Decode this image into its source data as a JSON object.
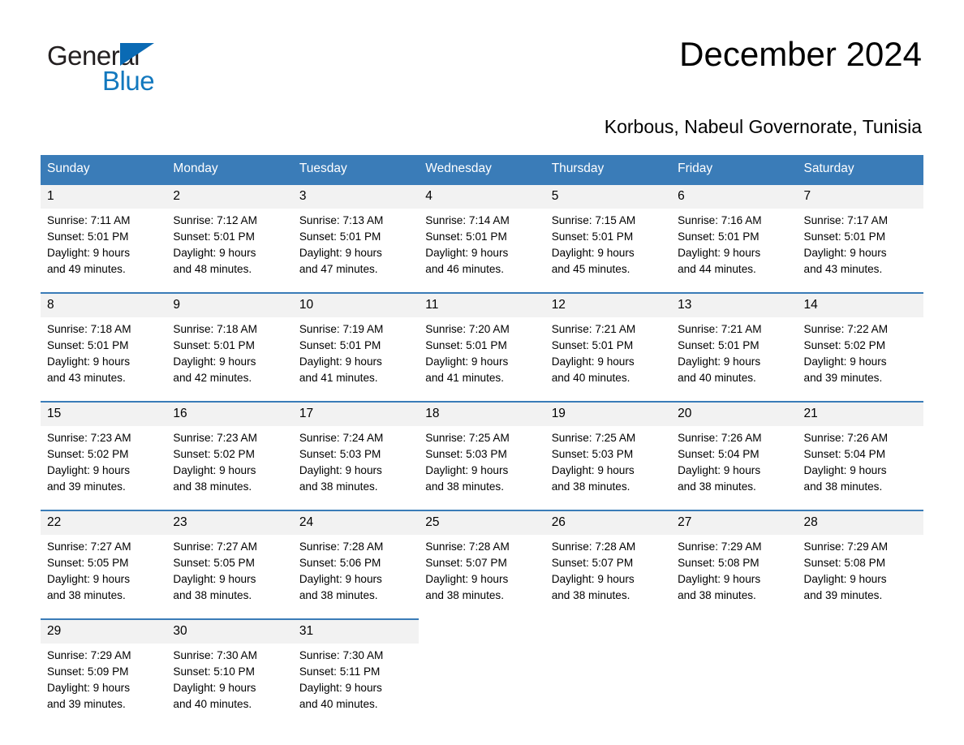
{
  "logo": {
    "word_one": "General",
    "word_two": "Blue",
    "flag_icon": "triangle-flag-icon",
    "brand_color": "#1278be"
  },
  "header": {
    "month_title": "December 2024",
    "location": "Korbous, Nabeul Governorate, Tunisia"
  },
  "calendar": {
    "header_color": "#3a7cb8",
    "weekday_headers": [
      "Sunday",
      "Monday",
      "Tuesday",
      "Wednesday",
      "Thursday",
      "Friday",
      "Saturday"
    ],
    "weeks": [
      [
        {
          "day": "1",
          "sunrise": "Sunrise: 7:11 AM",
          "sunset": "Sunset: 5:01 PM",
          "daylight_line1": "Daylight: 9 hours",
          "daylight_line2": "and 49 minutes."
        },
        {
          "day": "2",
          "sunrise": "Sunrise: 7:12 AM",
          "sunset": "Sunset: 5:01 PM",
          "daylight_line1": "Daylight: 9 hours",
          "daylight_line2": "and 48 minutes."
        },
        {
          "day": "3",
          "sunrise": "Sunrise: 7:13 AM",
          "sunset": "Sunset: 5:01 PM",
          "daylight_line1": "Daylight: 9 hours",
          "daylight_line2": "and 47 minutes."
        },
        {
          "day": "4",
          "sunrise": "Sunrise: 7:14 AM",
          "sunset": "Sunset: 5:01 PM",
          "daylight_line1": "Daylight: 9 hours",
          "daylight_line2": "and 46 minutes."
        },
        {
          "day": "5",
          "sunrise": "Sunrise: 7:15 AM",
          "sunset": "Sunset: 5:01 PM",
          "daylight_line1": "Daylight: 9 hours",
          "daylight_line2": "and 45 minutes."
        },
        {
          "day": "6",
          "sunrise": "Sunrise: 7:16 AM",
          "sunset": "Sunset: 5:01 PM",
          "daylight_line1": "Daylight: 9 hours",
          "daylight_line2": "and 44 minutes."
        },
        {
          "day": "7",
          "sunrise": "Sunrise: 7:17 AM",
          "sunset": "Sunset: 5:01 PM",
          "daylight_line1": "Daylight: 9 hours",
          "daylight_line2": "and 43 minutes."
        }
      ],
      [
        {
          "day": "8",
          "sunrise": "Sunrise: 7:18 AM",
          "sunset": "Sunset: 5:01 PM",
          "daylight_line1": "Daylight: 9 hours",
          "daylight_line2": "and 43 minutes."
        },
        {
          "day": "9",
          "sunrise": "Sunrise: 7:18 AM",
          "sunset": "Sunset: 5:01 PM",
          "daylight_line1": "Daylight: 9 hours",
          "daylight_line2": "and 42 minutes."
        },
        {
          "day": "10",
          "sunrise": "Sunrise: 7:19 AM",
          "sunset": "Sunset: 5:01 PM",
          "daylight_line1": "Daylight: 9 hours",
          "daylight_line2": "and 41 minutes."
        },
        {
          "day": "11",
          "sunrise": "Sunrise: 7:20 AM",
          "sunset": "Sunset: 5:01 PM",
          "daylight_line1": "Daylight: 9 hours",
          "daylight_line2": "and 41 minutes."
        },
        {
          "day": "12",
          "sunrise": "Sunrise: 7:21 AM",
          "sunset": "Sunset: 5:01 PM",
          "daylight_line1": "Daylight: 9 hours",
          "daylight_line2": "and 40 minutes."
        },
        {
          "day": "13",
          "sunrise": "Sunrise: 7:21 AM",
          "sunset": "Sunset: 5:01 PM",
          "daylight_line1": "Daylight: 9 hours",
          "daylight_line2": "and 40 minutes."
        },
        {
          "day": "14",
          "sunrise": "Sunrise: 7:22 AM",
          "sunset": "Sunset: 5:02 PM",
          "daylight_line1": "Daylight: 9 hours",
          "daylight_line2": "and 39 minutes."
        }
      ],
      [
        {
          "day": "15",
          "sunrise": "Sunrise: 7:23 AM",
          "sunset": "Sunset: 5:02 PM",
          "daylight_line1": "Daylight: 9 hours",
          "daylight_line2": "and 39 minutes."
        },
        {
          "day": "16",
          "sunrise": "Sunrise: 7:23 AM",
          "sunset": "Sunset: 5:02 PM",
          "daylight_line1": "Daylight: 9 hours",
          "daylight_line2": "and 38 minutes."
        },
        {
          "day": "17",
          "sunrise": "Sunrise: 7:24 AM",
          "sunset": "Sunset: 5:03 PM",
          "daylight_line1": "Daylight: 9 hours",
          "daylight_line2": "and 38 minutes."
        },
        {
          "day": "18",
          "sunrise": "Sunrise: 7:25 AM",
          "sunset": "Sunset: 5:03 PM",
          "daylight_line1": "Daylight: 9 hours",
          "daylight_line2": "and 38 minutes."
        },
        {
          "day": "19",
          "sunrise": "Sunrise: 7:25 AM",
          "sunset": "Sunset: 5:03 PM",
          "daylight_line1": "Daylight: 9 hours",
          "daylight_line2": "and 38 minutes."
        },
        {
          "day": "20",
          "sunrise": "Sunrise: 7:26 AM",
          "sunset": "Sunset: 5:04 PM",
          "daylight_line1": "Daylight: 9 hours",
          "daylight_line2": "and 38 minutes."
        },
        {
          "day": "21",
          "sunrise": "Sunrise: 7:26 AM",
          "sunset": "Sunset: 5:04 PM",
          "daylight_line1": "Daylight: 9 hours",
          "daylight_line2": "and 38 minutes."
        }
      ],
      [
        {
          "day": "22",
          "sunrise": "Sunrise: 7:27 AM",
          "sunset": "Sunset: 5:05 PM",
          "daylight_line1": "Daylight: 9 hours",
          "daylight_line2": "and 38 minutes."
        },
        {
          "day": "23",
          "sunrise": "Sunrise: 7:27 AM",
          "sunset": "Sunset: 5:05 PM",
          "daylight_line1": "Daylight: 9 hours",
          "daylight_line2": "and 38 minutes."
        },
        {
          "day": "24",
          "sunrise": "Sunrise: 7:28 AM",
          "sunset": "Sunset: 5:06 PM",
          "daylight_line1": "Daylight: 9 hours",
          "daylight_line2": "and 38 minutes."
        },
        {
          "day": "25",
          "sunrise": "Sunrise: 7:28 AM",
          "sunset": "Sunset: 5:07 PM",
          "daylight_line1": "Daylight: 9 hours",
          "daylight_line2": "and 38 minutes."
        },
        {
          "day": "26",
          "sunrise": "Sunrise: 7:28 AM",
          "sunset": "Sunset: 5:07 PM",
          "daylight_line1": "Daylight: 9 hours",
          "daylight_line2": "and 38 minutes."
        },
        {
          "day": "27",
          "sunrise": "Sunrise: 7:29 AM",
          "sunset": "Sunset: 5:08 PM",
          "daylight_line1": "Daylight: 9 hours",
          "daylight_line2": "and 38 minutes."
        },
        {
          "day": "28",
          "sunrise": "Sunrise: 7:29 AM",
          "sunset": "Sunset: 5:08 PM",
          "daylight_line1": "Daylight: 9 hours",
          "daylight_line2": "and 39 minutes."
        }
      ],
      [
        {
          "day": "29",
          "sunrise": "Sunrise: 7:29 AM",
          "sunset": "Sunset: 5:09 PM",
          "daylight_line1": "Daylight: 9 hours",
          "daylight_line2": "and 39 minutes."
        },
        {
          "day": "30",
          "sunrise": "Sunrise: 7:30 AM",
          "sunset": "Sunset: 5:10 PM",
          "daylight_line1": "Daylight: 9 hours",
          "daylight_line2": "and 40 minutes."
        },
        {
          "day": "31",
          "sunrise": "Sunrise: 7:30 AM",
          "sunset": "Sunset: 5:11 PM",
          "daylight_line1": "Daylight: 9 hours",
          "daylight_line2": "and 40 minutes."
        },
        {
          "day": "",
          "sunrise": "",
          "sunset": "",
          "daylight_line1": "",
          "daylight_line2": ""
        },
        {
          "day": "",
          "sunrise": "",
          "sunset": "",
          "daylight_line1": "",
          "daylight_line2": ""
        },
        {
          "day": "",
          "sunrise": "",
          "sunset": "",
          "daylight_line1": "",
          "daylight_line2": ""
        },
        {
          "day": "",
          "sunrise": "",
          "sunset": "",
          "daylight_line1": "",
          "daylight_line2": ""
        }
      ]
    ]
  }
}
